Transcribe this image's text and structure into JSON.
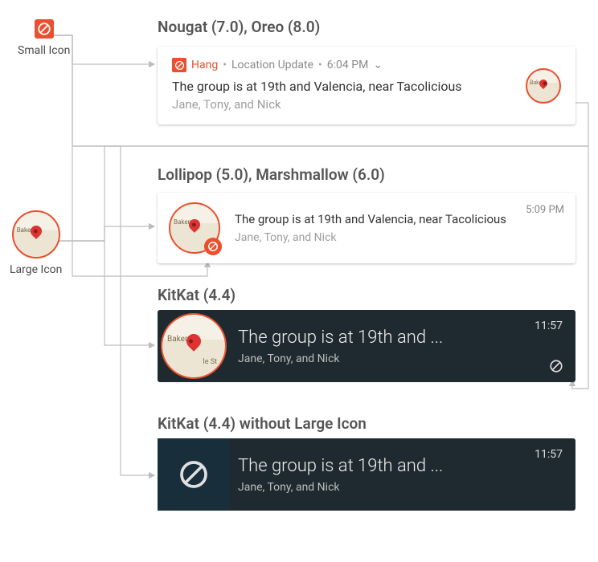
{
  "left": {
    "small_icon_label": "Small Icon",
    "large_icon_label": "Large Icon",
    "map_label_bakery": "Bakery",
    "map_label_street": "le St"
  },
  "sections": {
    "nougat_heading": "Nougat (7.0), Oreo (8.0)",
    "lollipop_heading": "Lollipop (5.0), Marshmallow (6.0)",
    "kitkat_heading": "KitKat (4.4)",
    "kitkat_nolg_heading": "KitKat (4.4) without Large Icon"
  },
  "nougat": {
    "app_name": "Hang",
    "category": "Location Update",
    "time": "6:04 PM",
    "title": "The group is at 19th and Valencia, near Tacolicious",
    "subtitle": "Jane, Tony, and Nick",
    "right_icon_label": "Bakery"
  },
  "lollipop": {
    "title": "The group is at 19th and Valencia, near Tacolicious",
    "subtitle": "Jane, Tony, and Nick",
    "time": "5:09 PM",
    "icon_label": "Bakery"
  },
  "kitkat": {
    "title": "The group is at 19th and ...",
    "subtitle": "Jane, Tony, and Nick",
    "time": "11:57",
    "icon_label_1": "Bakery",
    "icon_label_2": "le St"
  },
  "kitkat_nolg": {
    "title": "The group is at 19th and ...",
    "subtitle": "Jane, Tony, and Nick",
    "time": "11:57"
  }
}
